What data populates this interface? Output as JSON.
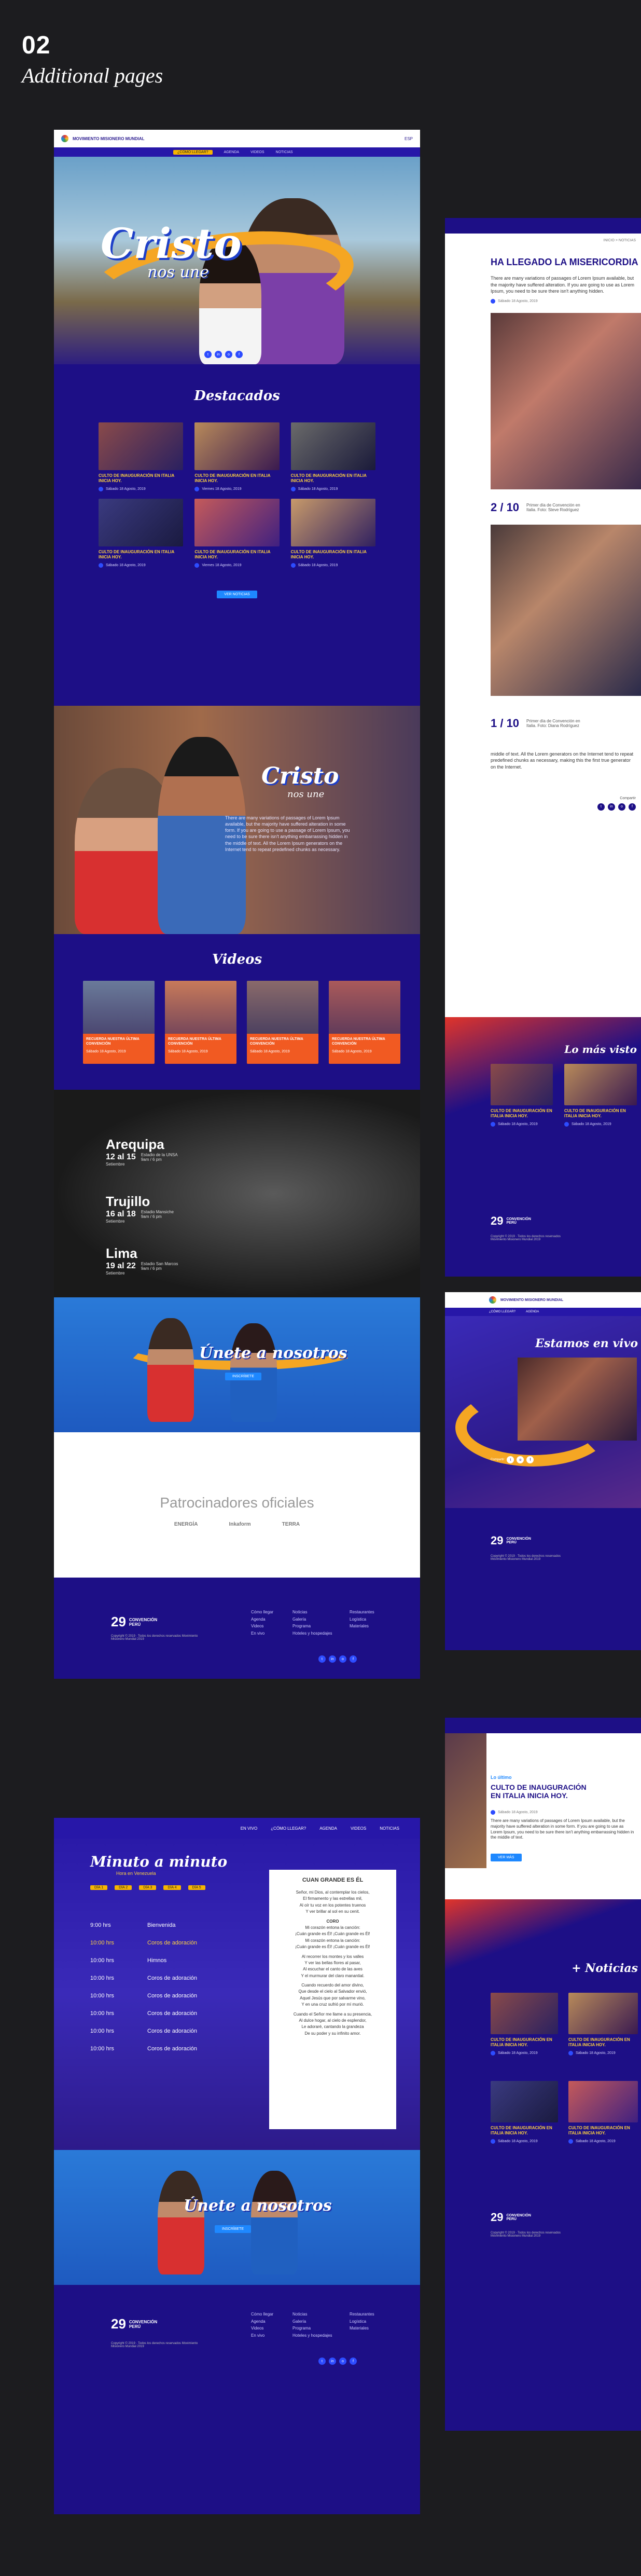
{
  "header": {
    "number": "02",
    "title": "Additional pages"
  },
  "site": {
    "brand": "MOVIMIENTO MISIONERO MUNDIAL",
    "lang": "ESP",
    "nav": [
      "¿CÓMO LLEGAR?",
      "AGENDA",
      "VIDEOS",
      "NOTICIAS"
    ],
    "hero_title": "Cristo",
    "hero_sub": "nos une",
    "social": [
      "t",
      "in",
      "o",
      "f"
    ],
    "featured_heading": "Destacados",
    "cards": [
      {
        "title": "CULTO DE INAUGURACIÓN EN ITALIA INICIA HOY.",
        "meta": "Sábado 18 Agosto, 2019"
      },
      {
        "title": "CULTO DE INAUGURACIÓN EN ITALIA INICIA HOY.",
        "meta": "Viernes 18 Agosto, 2019"
      },
      {
        "title": "CULTO DE INAUGURACIÓN EN ITALIA INICIA HOY.",
        "meta": "Sábado 18 Agosto, 2019"
      },
      {
        "title": "CULTO DE INAUGURACIÓN EN ITALIA INICIA HOY.",
        "meta": "Sábado 18 Agosto, 2019"
      },
      {
        "title": "CULTO DE INAUGURACIÓN EN ITALIA INICIA HOY.",
        "meta": "Viernes 18 Agosto, 2019"
      },
      {
        "title": "CULTO DE INAUGURACIÓN EN ITALIA INICIA HOY.",
        "meta": "Sábado 18 Agosto, 2019"
      }
    ],
    "more_btn": "VER NOTICIAS",
    "story_title": "Cristo",
    "story_sub": "nos une",
    "story_text": "There are many variations of passages of Lorem Ipsum available, but the majority have suffered alteration in some form. If you are going to use a passage of Lorem Ipsum, you need to be sure there isn't anything embarrassing hidden in the middle of text. All the Lorem Ipsum generators on the Internet tend to repeat predefined chunks as necessary.",
    "videos_heading": "Videos",
    "videos": [
      {
        "title": "RECUERDA NUESTRA ÚLTIMA CONVENCIÓN",
        "meta": "Sábado 18 Agosto, 2019"
      },
      {
        "title": "RECUERDA NUESTRA ÚLTIMA CONVENCIÓN",
        "meta": "Sábado 18 Agosto, 2019"
      },
      {
        "title": "RECUERDA NUESTRA ÚLTIMA CONVENCIÓN",
        "meta": "Sábado 18 Agosto, 2019"
      },
      {
        "title": "RECUERDA NUESTRA ÚLTIMA CONVENCIÓN",
        "meta": "Sábado 18 Agosto, 2019"
      }
    ],
    "cities": [
      {
        "name": "Arequipa",
        "date": "12 al 15",
        "month": "Setiembre",
        "place": "Estadio de la UNSA",
        "time": "9am / 6 pm"
      },
      {
        "name": "Trujillo",
        "date": "16 al 18",
        "month": "Setiembre",
        "place": "Estadio Mansiche",
        "time": "9am / 6 pm"
      },
      {
        "name": "Lima",
        "date": "19 al 22",
        "month": "Setiembre",
        "place": "Estadio San Marcos",
        "time": "9am / 6 pm"
      }
    ],
    "join_title": "Únete a nosotros",
    "join_btn": "INSCRÍBETE",
    "sponsors_heading": "Patrocinadores oficiales",
    "sponsor_names": [
      "ENERGÍA",
      "Inkaform",
      "TERRA"
    ],
    "footer_brand": "29",
    "footer_brand_sub": "CONVENCIÓN PERÚ",
    "footer_copy": "Copyright © 2019 · Todos los derechos reservados Movimiento Misionero Mundial 2019",
    "footer_cols": [
      [
        "Cómo llegar",
        "Agenda",
        "Videos",
        "En vivo"
      ],
      [
        "Noticias",
        "Galería",
        "Programa",
        "Hoteles y hospedajes"
      ],
      [
        "Restaurantes",
        "Logística",
        "Materiales"
      ]
    ]
  },
  "schedule": {
    "nav": [
      "EN VIVO",
      "¿CÓMO LLEGAR?",
      "AGENDA",
      "VIDEOS",
      "NOTICIAS"
    ],
    "heading": "Minuto a minuto",
    "subheading": "Hora en Venezuela",
    "days": [
      "DÍA 1",
      "DÍA 2",
      "DÍA 3",
      "DÍA 4",
      "DÍA 5"
    ],
    "rows": [
      {
        "time": "9:00 hrs",
        "label": "Bienvenida"
      },
      {
        "time": "10:00 hrs",
        "label": "Coros de adoración"
      },
      {
        "time": "10:00 hrs",
        "label": "Himnos"
      },
      {
        "time": "10:00 hrs",
        "label": "Coros de adoración"
      },
      {
        "time": "10:00 hrs",
        "label": "Coros de adoración"
      },
      {
        "time": "10:00 hrs",
        "label": "Coros de adoración"
      },
      {
        "time": "10:00 hrs",
        "label": "Coros de adoración"
      },
      {
        "time": "10:00 hrs",
        "label": "Coros de adoración"
      }
    ],
    "song_title": "CUAN GRANDE ES ÉL",
    "song_lines": [
      "Señor, mi Dios, al contemplar los cielos,",
      "El firmamento y las estrellas mil,",
      "Al oír tu voz en los potentes truenos",
      "Y ver brillar al sol en su cenit.",
      "CORO",
      "Mi corazón entona la canción:",
      "¡Cuán grande es Él! ¡Cuán grande es Él!",
      "Mi corazón entona la canción:",
      "¡Cuán grande es Él! ¡Cuán grande es Él!",
      "Al recorrer los montes y los valles",
      "Y ver las bellas flores al pasar,",
      "Al escuchar el canto de las aves",
      "Y el murmurar del claro manantial.",
      "Cuando recuerdo del amor divino,",
      "Que desde el cielo al Salvador envió,",
      "Aquel Jesús que por salvarme vino,",
      "Y en una cruz sufrió por mí murió.",
      "Cuando el Señor me llame a su presencia,",
      "Al dulce hogar, al cielo de esplendor,",
      "Le adoraré, cantando la grandeza",
      "De su poder y su infinito amor."
    ],
    "join_title": "Únete a nosotros",
    "join_btn": "INSCRÍBETE"
  },
  "article": {
    "breadcrumb": "INICIO > NOTICIAS",
    "title": "HA LLEGADO LA MISERICORDIA",
    "intro": "There are many variations of passages of Lorem Ipsum available, but the majority have suffered alteration. If you are going to use as Lorem Ipsum, you need to be sure there isn't anything hidden.",
    "meta": "Sábado 18 Agosto, 2019",
    "body": "middle of text. All the Lorem generators on the Internet tend to repeat predefined chunks as necessary, making this the first true generator on the Internet.",
    "gallery": [
      {
        "count": "2 / 10",
        "caption": "Primer día de Convención en Italia. Foto: Steve Rodríguez"
      },
      {
        "count": "1 / 10",
        "caption": "Primer día de Convención en Italia. Foto: Diana Rodríguez"
      }
    ],
    "share": "Compartir",
    "more_heading": "Lo más visto",
    "card_title": "CULTO DE INAUGURACIÓN EN ITALIA INICIA HOY.",
    "card_meta": "Sábado 18 Agosto, 2019"
  },
  "live": {
    "heading": "Estamos en vivo",
    "nav": [
      "¿CÓMO LLEGAR?",
      "AGENDA"
    ]
  },
  "news": {
    "kicker": "Lo último",
    "title": "CULTO DE INAUGURACIÓN EN ITALIA INICIA HOY.",
    "meta": "Sábado 18 Agosto, 2019",
    "text": "There are many variations of passages of Lorem Ipsum available, but the majority have suffered alteration in some form. If you are going to use as Lorem Ipsum, you need to be sure there isn't anything embarrassing hidden in the middle of text.",
    "btn": "VER MÁS",
    "heading": "+ Noticias"
  },
  "colors": {
    "navy": "#1d0f86",
    "yellow": "#ffd23f",
    "orange": "#f15a22",
    "blue": "#2d4cff"
  }
}
